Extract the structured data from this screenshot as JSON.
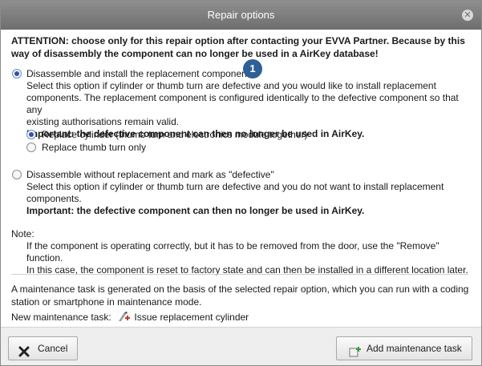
{
  "dialog": {
    "title": "Repair options",
    "close_icon": "close-icon"
  },
  "attention": "ATTENTION: choose only for this repair option after contacting your EVVA Partner. Because by this way of disassembly the component can no longer be used in a AirKey database!",
  "option1": {
    "label": "Disassemble and install the replacement components",
    "badge": "1",
    "desc1": "Select this option if cylinder or thumb turn are defective and you would like to install replacement",
    "desc2": "components. The replacement component is configured identically to the defective component so that any",
    "desc3": "existing authorisations remain valid.",
    "important": "Important: the defective component can then no longer be used in AirKey.",
    "sub_options": [
      {
        "label": "Replace cylinder (thumb turn and electronics module together)",
        "checked": true
      },
      {
        "label": "Replace thumb turn only",
        "checked": false
      }
    ],
    "checked": true
  },
  "option2": {
    "label": "Disassemble without replacement and mark as \"defective\"",
    "desc1": "Select this option if cylinder or thumb turn are defective and you do not want to install replacement",
    "desc2": "components.",
    "important": "Important: the defective component can then no longer be used in AirKey.",
    "checked": false
  },
  "note": {
    "title": "Note:",
    "line1": "If the component is operating correctly, but it has to be removed from the door, use the \"Remove\" function.",
    "line2": "In this case, the component is reset to factory state and can then be installed in a different location later."
  },
  "maintenance": {
    "info": "A maintenance task is generated on the basis of the selected repair option, which you can run with a coding station or smartphone in maintenance mode.",
    "label": "New maintenance task:",
    "task": "Issue replacement cylinder",
    "task_icon": "replacement-cylinder-icon"
  },
  "footer": {
    "cancel_label": "Cancel",
    "add_label": "Add maintenance task"
  },
  "colors": {
    "titlebar": "#7f7f7f",
    "badge": "#2e5f98",
    "radio_selected": "#2a56a8",
    "cancel_x": "#222222",
    "add_icon_green": "#3a9a3a"
  }
}
